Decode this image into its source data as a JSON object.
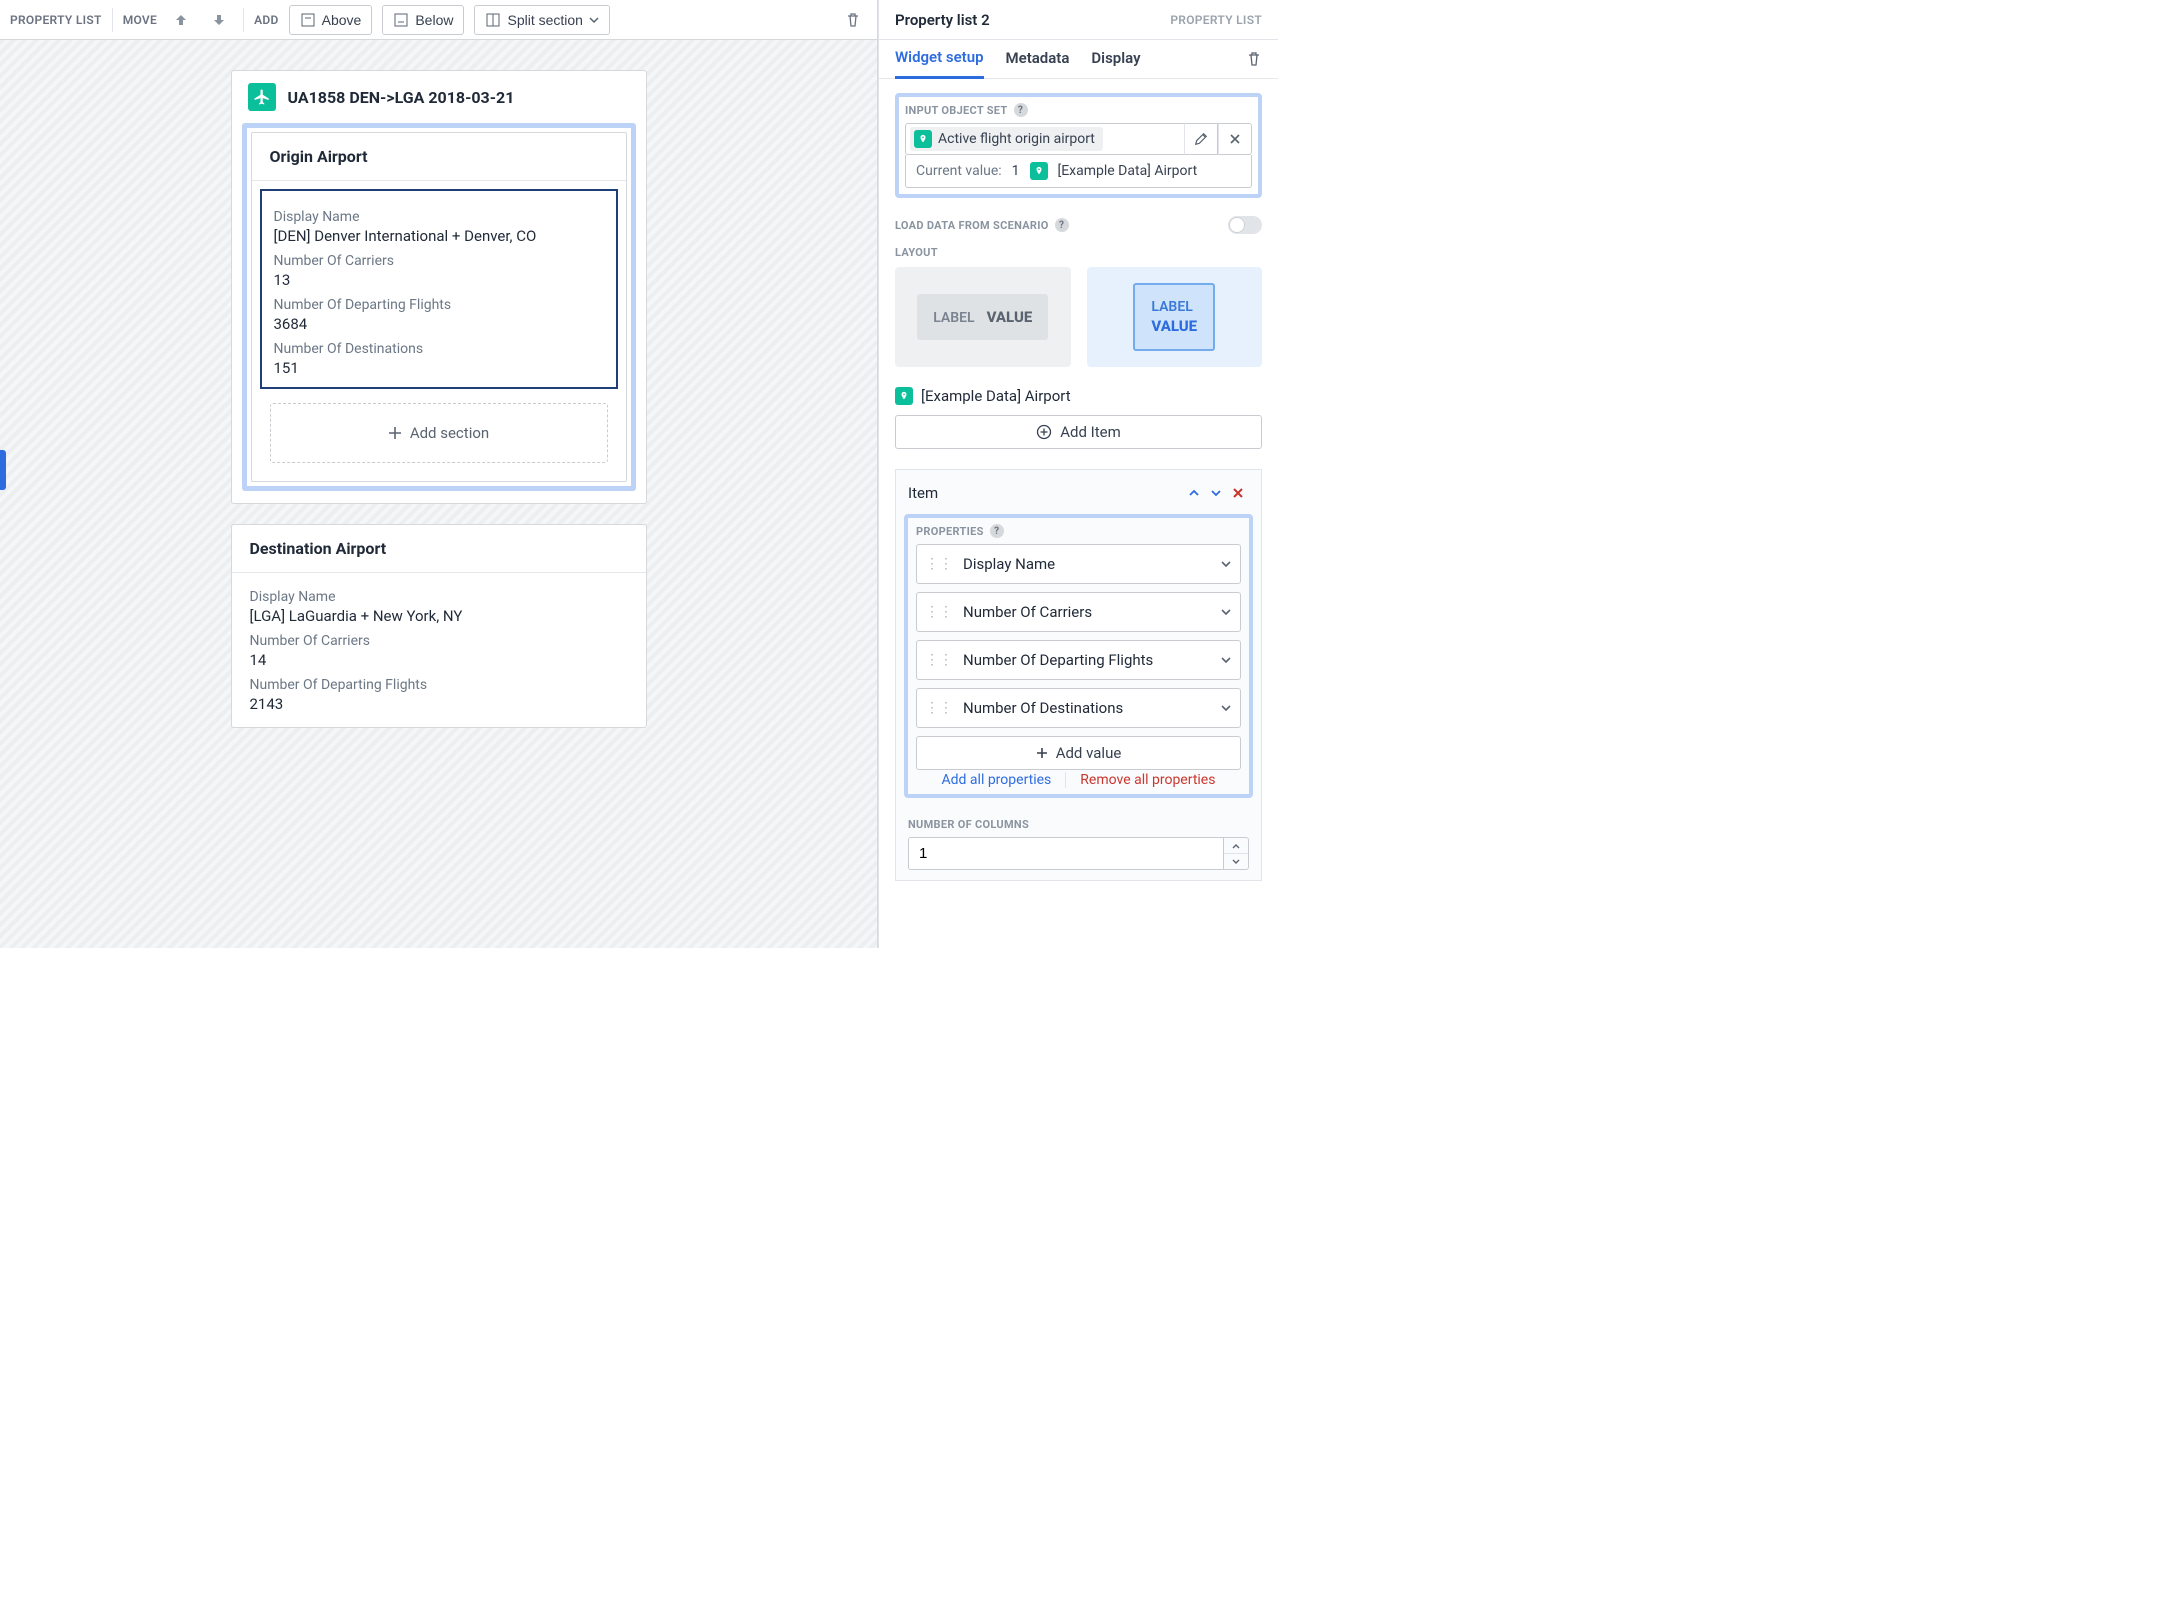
{
  "toolbar": {
    "list_label": "PROPERTY LIST",
    "move_label": "MOVE",
    "add_label": "ADD",
    "above": "Above",
    "below": "Below",
    "split": "Split section"
  },
  "flight_title": "UA1858 DEN->LGA 2018-03-21",
  "origin": {
    "title": "Origin Airport",
    "props": [
      {
        "label": "Display Name",
        "value": "[DEN] Denver International + Denver, CO"
      },
      {
        "label": "Number Of Carriers",
        "value": "13"
      },
      {
        "label": "Number Of Departing Flights",
        "value": "3684"
      },
      {
        "label": "Number Of Destinations",
        "value": "151"
      }
    ],
    "add_section": "Add section"
  },
  "destination": {
    "title": "Destination Airport",
    "props": [
      {
        "label": "Display Name",
        "value": "[LGA] LaGuardia + New York, NY"
      },
      {
        "label": "Number Of Carriers",
        "value": "14"
      },
      {
        "label": "Number Of Departing Flights",
        "value": "2143"
      }
    ]
  },
  "panel": {
    "title": "Property list 2",
    "type": "PROPERTY LIST",
    "tabs": {
      "widget": "Widget setup",
      "metadata": "Metadata",
      "display": "Display"
    },
    "input_object_set_label": "INPUT OBJECT SET",
    "chip": "Active flight origin airport",
    "current_value_label": "Current value:",
    "current_value_count": "1",
    "current_value_obj": "[Example Data] Airport",
    "load_from_scenario_label": "LOAD DATA FROM SCENARIO",
    "layout_label": "LAYOUT",
    "layout_inline": {
      "label": "LABEL",
      "value": "VALUE"
    },
    "layout_stack": {
      "label": "LABEL",
      "value": "VALUE"
    },
    "obj_title": "[Example Data] Airport",
    "add_item": "Add Item",
    "item_title": "Item",
    "properties_label": "PROPERTIES",
    "properties": [
      "Display Name",
      "Number Of Carriers",
      "Number Of Departing Flights",
      "Number Of Destinations"
    ],
    "add_value": "Add value",
    "add_all": "Add all properties",
    "remove_all": "Remove all properties",
    "num_cols_label": "NUMBER OF COLUMNS",
    "num_cols_value": "1"
  }
}
